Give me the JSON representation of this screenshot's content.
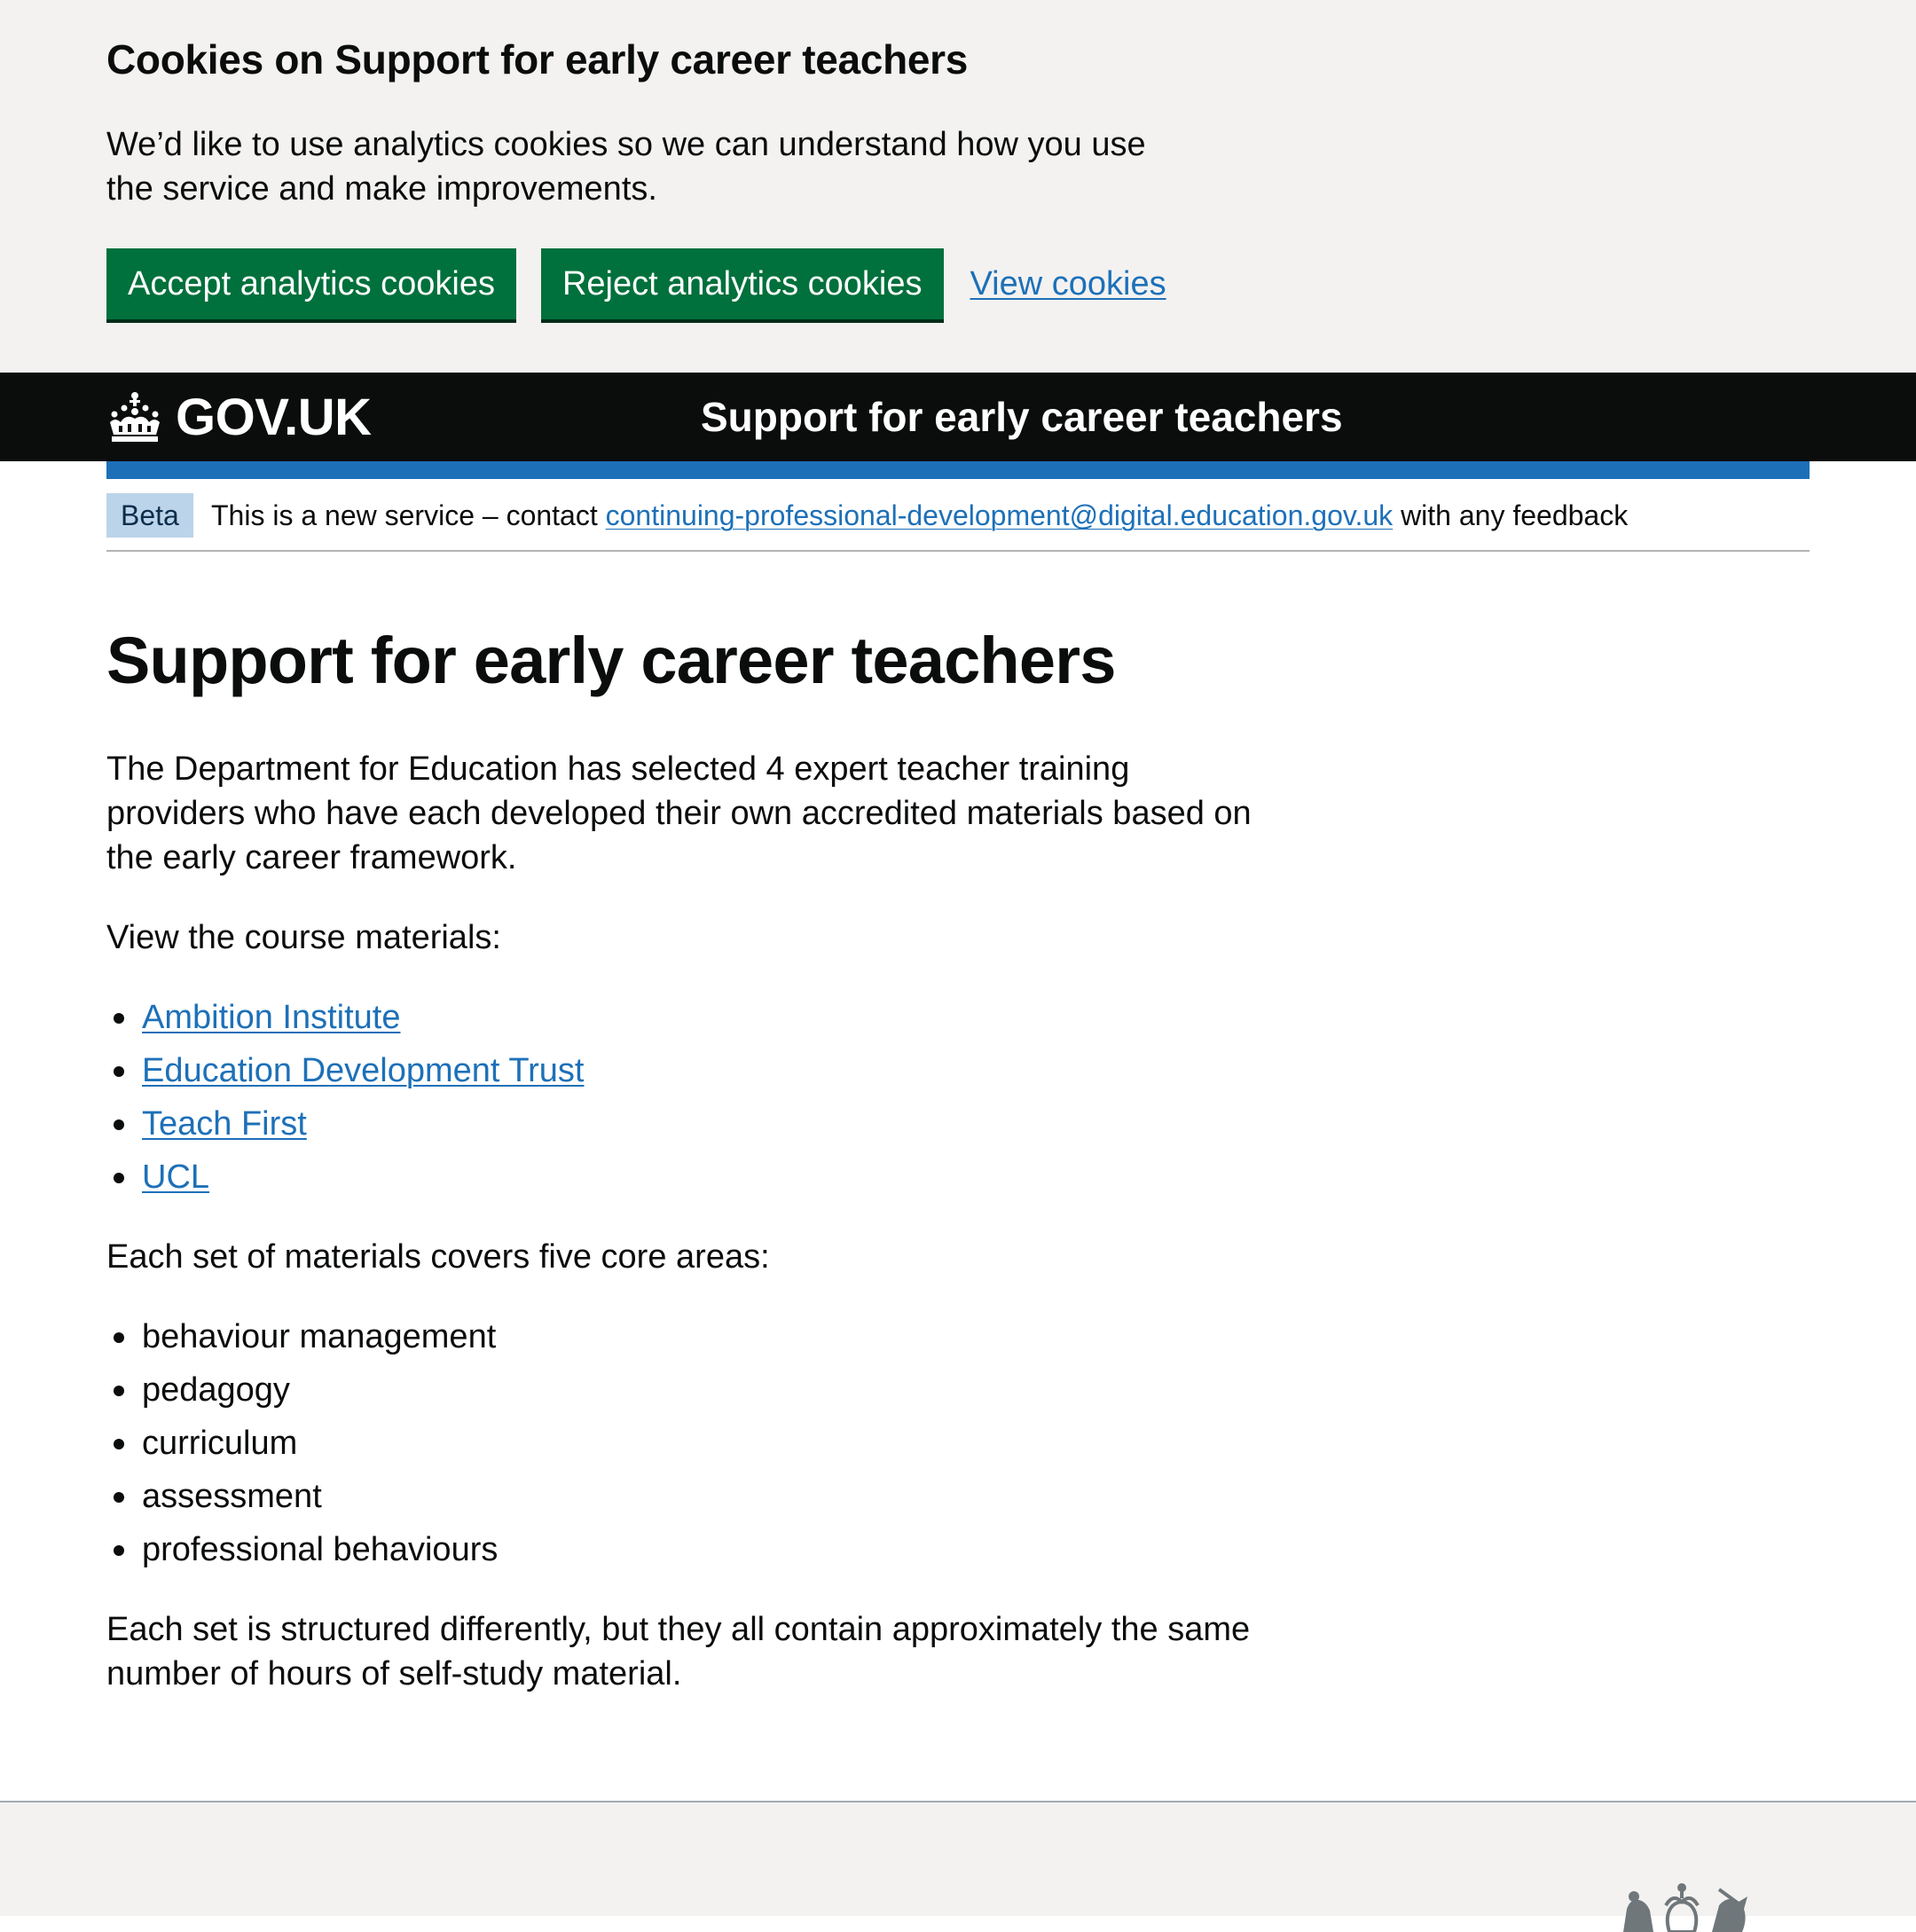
{
  "cookie_banner": {
    "title": "Cookies on Support for early career teachers",
    "text": "We’d like to use analytics cookies so we can understand how you use the service and make improvements.",
    "accept_label": "Accept analytics cookies",
    "reject_label": "Reject analytics cookies",
    "view_label": "View cookies"
  },
  "header": {
    "logo_text": "GOV.UK",
    "logo_icon": "crown-icon",
    "service_name": "Support for early career teachers",
    "accent_color": "#1d70b8"
  },
  "phase_banner": {
    "tag": "Beta",
    "text_before": "This is a new service – contact",
    "email_link": "continuing-professional-development@digital.education.gov.uk",
    "text_after": "with any feedback"
  },
  "main": {
    "title": "Support for early career teachers",
    "intro": "The Department for Education has selected 4 expert teacher training providers who have each developed their own accredited materials based on the early career framework.",
    "view_materials": "View the course materials:",
    "providers": [
      "Ambition Institute",
      "Education Development Trust",
      "Teach First",
      "UCL"
    ],
    "core_intro": "Each set of materials covers five core areas:",
    "core_areas": [
      "behaviour management",
      "pedagogy",
      "curriculum",
      "assessment",
      "professional behaviours"
    ],
    "closing": "Each set is structured differently, but they all contain approximately the same number of hours of self-study material."
  },
  "footer": {
    "crest_icon": "royal-coat-of-arms-icon"
  }
}
